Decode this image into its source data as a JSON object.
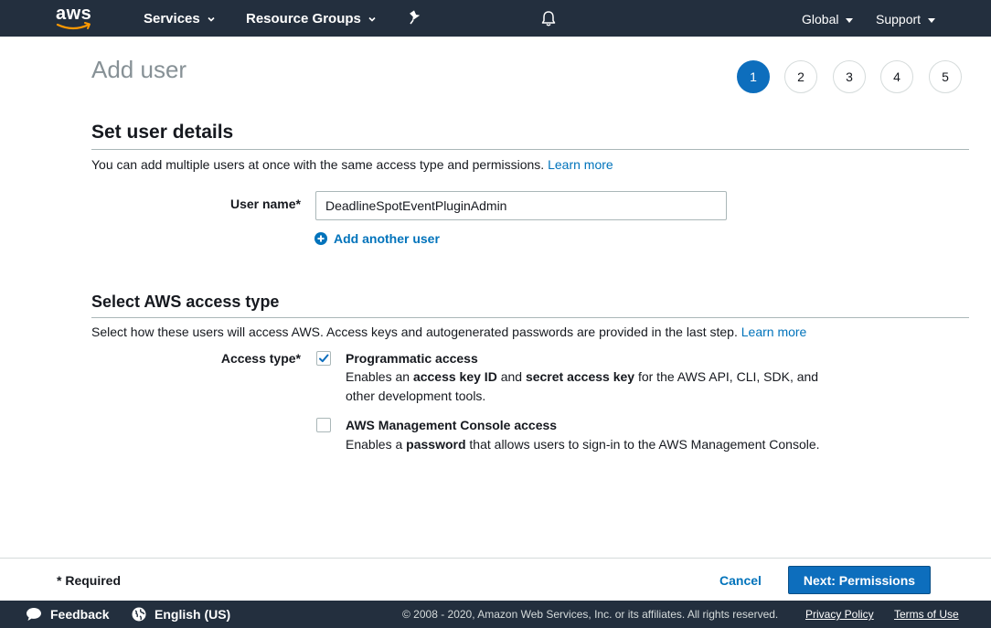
{
  "topnav": {
    "logo_text": "aws",
    "services_label": "Services",
    "resource_groups_label": "Resource Groups",
    "region_label": "Global",
    "support_label": "Support",
    "bg_color": "#232f3e"
  },
  "page": {
    "title": "Add user"
  },
  "steps": [
    "1",
    "2",
    "3",
    "4",
    "5"
  ],
  "active_step": "1",
  "details_section": {
    "title": "Set user details",
    "description": "You can add multiple users at once with the same access type and permissions.",
    "learn_more": "Learn more",
    "user_name_label": "User name*",
    "user_name_value": "DeadlineSpotEventPluginAdmin",
    "add_another_user": "Add another user"
  },
  "access_section": {
    "title": "Select AWS access type",
    "description": "Select how these users will access AWS. Access keys and autogenerated passwords are provided in the last step.",
    "learn_more": "Learn more",
    "access_type_label": "Access type*",
    "programmatic": {
      "title": "Programmatic access",
      "checked": true,
      "desc_prefix": "Enables an ",
      "desc_bold1": "access key ID",
      "desc_mid": " and ",
      "desc_bold2": "secret access key",
      "desc_suffix": " for the AWS API, CLI, SDK, and other development tools."
    },
    "console": {
      "title": "AWS Management Console access",
      "checked": false,
      "desc_prefix": "Enables a ",
      "desc_bold": "password",
      "desc_suffix": " that allows users to sign-in to the AWS Management Console."
    }
  },
  "action_bar": {
    "required_note": "* Required",
    "cancel_label": "Cancel",
    "next_label": "Next: Permissions"
  },
  "footer": {
    "feedback_label": "Feedback",
    "language_label": "English (US)",
    "copyright": "© 2008 - 2020, Amazon Web Services, Inc. or its affiliates. All rights reserved.",
    "privacy_label": "Privacy Policy",
    "terms_label": "Terms of Use"
  },
  "colors": {
    "accent": "#0d6ebd",
    "link": "#0073bb"
  }
}
